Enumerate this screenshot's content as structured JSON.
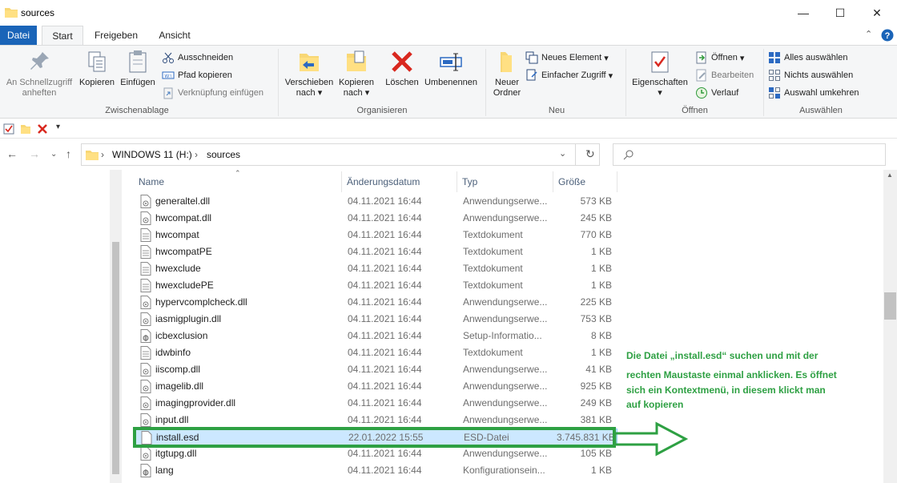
{
  "window": {
    "title": "sources",
    "minimize": "—",
    "maximize": "☐",
    "close": "✕"
  },
  "ribbon_tabs": [
    {
      "label": "Datei"
    },
    {
      "label": "Start"
    },
    {
      "label": "Freigeben"
    },
    {
      "label": "Ansicht"
    }
  ],
  "ribbon": {
    "clipboard": {
      "label": "Zwischenablage",
      "pin": "An Schnellzugriff anheften",
      "pin_line1": "An Schnellzugriff",
      "pin_line2": "anheften",
      "copy": "Kopieren",
      "paste": "Einfügen",
      "cut": "Ausschneiden",
      "copy_path": "Pfad kopieren",
      "paste_shortcut": "Verknüpfung einfügen"
    },
    "organize": {
      "label": "Organisieren",
      "move_line1": "Verschieben",
      "move_line2": "nach",
      "copyto_line1": "Kopieren",
      "copyto_line2": "nach",
      "delete": "Löschen",
      "rename": "Umbenennen"
    },
    "new": {
      "label": "Neu",
      "folder_line1": "Neuer",
      "folder_line2": "Ordner",
      "new_item": "Neues Element",
      "easy_access": "Einfacher Zugriff"
    },
    "open": {
      "label": "Öffnen",
      "properties": "Eigenschaften",
      "open": "Öffnen",
      "edit": "Bearbeiten",
      "history": "Verlauf"
    },
    "select": {
      "label": "Auswählen",
      "select_all": "Alles auswählen",
      "select_none": "Nichts auswählen",
      "invert": "Auswahl umkehren"
    }
  },
  "address": {
    "drive": "WINDOWS 11 (H:)",
    "folder": "sources",
    "sep": "›"
  },
  "columns": {
    "name": "Name",
    "date": "Änderungsdatum",
    "type": "Typ",
    "size": "Größe"
  },
  "files": [
    {
      "name": "generaltel.dll",
      "date": "04.11.2021 16:44",
      "type": "Anwendungserwe...",
      "size": "573 KB",
      "icon": "dll"
    },
    {
      "name": "hwcompat.dll",
      "date": "04.11.2021 16:44",
      "type": "Anwendungserwe...",
      "size": "245 KB",
      "icon": "dll"
    },
    {
      "name": "hwcompat",
      "date": "04.11.2021 16:44",
      "type": "Textdokument",
      "size": "770 KB",
      "icon": "txt"
    },
    {
      "name": "hwcompatPE",
      "date": "04.11.2021 16:44",
      "type": "Textdokument",
      "size": "1 KB",
      "icon": "txt"
    },
    {
      "name": "hwexclude",
      "date": "04.11.2021 16:44",
      "type": "Textdokument",
      "size": "1 KB",
      "icon": "txt"
    },
    {
      "name": "hwexcludePE",
      "date": "04.11.2021 16:44",
      "type": "Textdokument",
      "size": "1 KB",
      "icon": "txt"
    },
    {
      "name": "hypervcomplcheck.dll",
      "date": "04.11.2021 16:44",
      "type": "Anwendungserwe...",
      "size": "225 KB",
      "icon": "dll"
    },
    {
      "name": "iasmigplugin.dll",
      "date": "04.11.2021 16:44",
      "type": "Anwendungserwe...",
      "size": "753 KB",
      "icon": "dll"
    },
    {
      "name": "icbexclusion",
      "date": "04.11.2021 16:44",
      "type": "Setup-Informatio...",
      "size": "8 KB",
      "icon": "inf"
    },
    {
      "name": "idwbinfo",
      "date": "04.11.2021 16:44",
      "type": "Textdokument",
      "size": "1 KB",
      "icon": "txt"
    },
    {
      "name": "iiscomp.dll",
      "date": "04.11.2021 16:44",
      "type": "Anwendungserwe...",
      "size": "41 KB",
      "icon": "dll"
    },
    {
      "name": "imagelib.dll",
      "date": "04.11.2021 16:44",
      "type": "Anwendungserwe...",
      "size": "925 KB",
      "icon": "dll"
    },
    {
      "name": "imagingprovider.dll",
      "date": "04.11.2021 16:44",
      "type": "Anwendungserwe...",
      "size": "249 KB",
      "icon": "dll"
    },
    {
      "name": "input.dll",
      "date": "04.11.2021 16:44",
      "type": "Anwendungserwe...",
      "size": "381 KB",
      "icon": "dll"
    },
    {
      "name": "install.esd",
      "date": "22.01.2022 15:55",
      "type": "ESD-Datei",
      "size": "3.745.831 KB",
      "icon": "blank",
      "selected": true
    },
    {
      "name": "itgtupg.dll",
      "date": "04.11.2021 16:44",
      "type": "Anwendungserwe...",
      "size": "105 KB",
      "icon": "dll"
    },
    {
      "name": "lang",
      "date": "04.11.2021 16:44",
      "type": "Konfigurationsein...",
      "size": "1 KB",
      "icon": "ini"
    }
  ],
  "annotation": {
    "line1": "Die Datei „install.esd“ suchen und mit der",
    "line2": "rechten Maustaste einmal anklicken. Es öffnet",
    "line3": "sich ein Kontextmenü, in diesem klickt man",
    "line4": "auf kopieren",
    "color": "#2ea043"
  },
  "colors": {
    "file_tab": "#1a64b8",
    "selection": "#cce8ff",
    "annotation": "#2ea043"
  }
}
